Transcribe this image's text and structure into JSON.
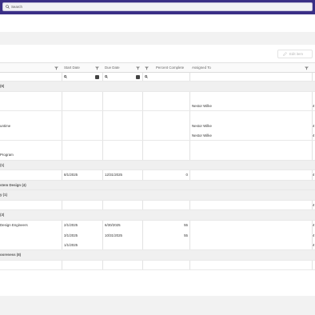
{
  "search": {
    "placeholder": "Search"
  },
  "toolbar": {
    "edit_label": "Edit item"
  },
  "columns": {
    "start": "Start Date",
    "due": "Due Date",
    "pct": "Percent Complete",
    "assigned": "Assigned To"
  },
  "groups": [
    "(6)",
    "(1)",
    "stem Design (4)",
    "y (1)",
    "(3)",
    "ooreness (8)"
  ],
  "rows": {
    "r1": {
      "assigned": "Nestor Wilke"
    },
    "r2": {
      "name": "untime",
      "assigned": "Nestor Wilke"
    },
    "r3": {
      "assigned": "Nestor Wilke"
    },
    "r4": {
      "name": "Program"
    },
    "r5": {
      "start": "8/1/2025",
      "due": "12/31/2025",
      "pct": "0"
    },
    "r6": {
      "name": "Design Engineers",
      "start": "2/1/2025",
      "due": "6/30/2025",
      "pct": "55"
    },
    "r7": {
      "start": "3/1/2025",
      "due": "10/31/2025",
      "pct": "55"
    },
    "r8": {
      "start": "1/1/2025"
    }
  },
  "edge_char": "4"
}
